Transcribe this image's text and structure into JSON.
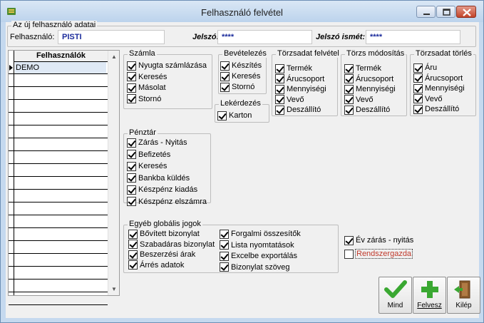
{
  "window": {
    "title": "Felhasználó felvétel"
  },
  "new_user": {
    "group_title": "Az új felhasználó adatai",
    "user_label": "Felhasználó:",
    "user_value": "PISTI",
    "password_label": "Jelszó:",
    "password_value": "****",
    "password_repeat_label": "Jelszó ismét:",
    "password_repeat_value": "****"
  },
  "users_grid": {
    "header": "Felhasználók",
    "rows": [
      "DEMO",
      "",
      "",
      "",
      "",
      "",
      "",
      "",
      "",
      "",
      "",
      "",
      "",
      "",
      "",
      "",
      "",
      "",
      ""
    ]
  },
  "szamla": {
    "title": "Számla",
    "items": [
      {
        "label": "Nyugta számlázása",
        "checked": true
      },
      {
        "label": "Keresés",
        "checked": true
      },
      {
        "label": "Másolat",
        "checked": true
      },
      {
        "label": "Stornó",
        "checked": true
      }
    ]
  },
  "bevetelezes": {
    "title": "Bevételezés",
    "items": [
      {
        "label": "Készítés",
        "checked": true
      },
      {
        "label": "Keresés",
        "checked": true
      },
      {
        "label": "Stornó",
        "checked": true
      }
    ]
  },
  "lekerdezes": {
    "title": "Lekérdezés",
    "items": [
      {
        "label": "Karton",
        "checked": true
      }
    ]
  },
  "torzsadat_felvetel": {
    "title": "Törzsadat felvétel",
    "items": [
      {
        "label": "Termék",
        "checked": true
      },
      {
        "label": "Árucsoport",
        "checked": true
      },
      {
        "label": "Mennyiségi",
        "checked": true
      },
      {
        "label": "Vevő",
        "checked": true
      },
      {
        "label": "Deszállító",
        "checked": true
      }
    ]
  },
  "torzs_modositas": {
    "title": "Törzs módosítás",
    "items": [
      {
        "label": "Termék",
        "checked": true
      },
      {
        "label": "Árucsoport",
        "checked": true
      },
      {
        "label": "Mennyiségi",
        "checked": true
      },
      {
        "label": "Vevő",
        "checked": true
      },
      {
        "label": "Deszállító",
        "checked": true
      }
    ]
  },
  "torzsadat_torles": {
    "title": "Törzsadat törlés",
    "items": [
      {
        "label": "Áru",
        "checked": true
      },
      {
        "label": "Árucsoport",
        "checked": true
      },
      {
        "label": "Mennyiségi",
        "checked": true
      },
      {
        "label": "Vevő",
        "checked": true
      },
      {
        "label": "Deszállító",
        "checked": true
      }
    ]
  },
  "penztar": {
    "title": "Pénztár",
    "items": [
      {
        "label": "Zárás - Nyitás",
        "checked": true
      },
      {
        "label": "Befizetés",
        "checked": true
      },
      {
        "label": "Keresés",
        "checked": true
      },
      {
        "label": "Bankba küldés",
        "checked": true
      },
      {
        "label": "Készpénz kiadás",
        "checked": true
      },
      {
        "label": "Készpénz elszámra",
        "checked": true
      }
    ]
  },
  "global": {
    "title": "Egyéb globális jogok",
    "col1": [
      {
        "label": "Bővített bizonylat",
        "checked": true
      },
      {
        "label": "Szabadáras bizonylat",
        "checked": true
      },
      {
        "label": "Beszerzési árak",
        "checked": true
      },
      {
        "label": "Árrés adatok",
        "checked": true
      }
    ],
    "col2": [
      {
        "label": "Forgalmi összesítők",
        "checked": true
      },
      {
        "label": "Lista nyomtatások",
        "checked": true
      },
      {
        "label": "Excelbe exportálás",
        "checked": true
      },
      {
        "label": "Bizonylat szöveg",
        "checked": true
      }
    ]
  },
  "extra": [
    {
      "label": "Év zárás - nyitás",
      "checked": true
    },
    {
      "label": "Rendszergazda",
      "checked": false
    }
  ],
  "buttons": {
    "all": "Mind",
    "add": "Felvesz",
    "exit": "Kilép"
  },
  "colors": {
    "title_bg": "#c8dcf1",
    "input_text": "#1c2c9c",
    "ok_green": "#3aa832",
    "focus_red": "#c0392b"
  }
}
